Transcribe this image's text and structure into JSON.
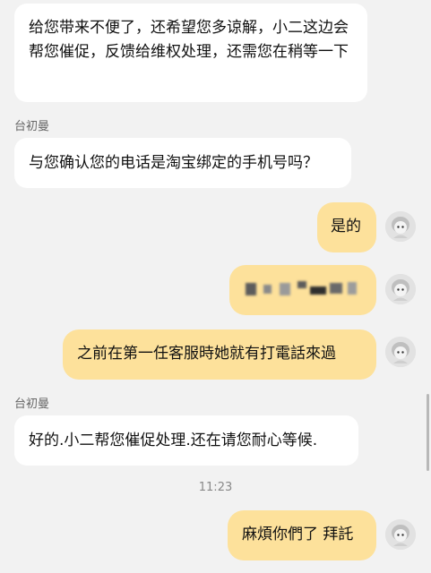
{
  "messages": [
    {
      "sender": "",
      "text": "给您带来不便了，还希望您多谅解，小二这边会帮您催促，反馈给维权处理，还需您在稍等一下"
    },
    {
      "sender": "台初曼",
      "text": "与您确认您的电话是淘宝绑定的手机号吗？"
    },
    {
      "sender": "me",
      "text": "是的"
    },
    {
      "sender": "me",
      "text": ""
    },
    {
      "sender": "me",
      "text": "之前在第一任客服時她就有打電話來過"
    },
    {
      "sender": "台初曼",
      "text": "好的.小二帮您催促处理.还在请您耐心等候."
    },
    {
      "time": "11:23"
    },
    {
      "sender": "me",
      "text": "麻煩你們了 拜託"
    }
  ],
  "avatar_icon": "anime-avatar-icon",
  "colors": {
    "background": "#f2f2f2",
    "left_bubble": "#ffffff",
    "right_bubble": "#fde19b"
  }
}
